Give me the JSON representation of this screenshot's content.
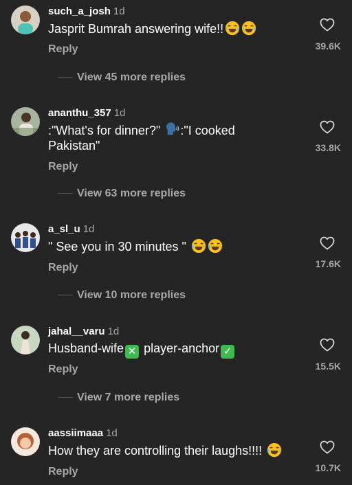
{
  "comments": [
    {
      "username": "such_a_josh",
      "time": "1d",
      "text": "Jasprit Bumrah answering wife!!",
      "reply_label": "Reply",
      "likes": "39.6K",
      "more_replies": "View 45 more replies"
    },
    {
      "username": "ananthu_357",
      "time": "1d",
      "text_a": ":\"What's for dinner?\"",
      "text_b": ":\"I cooked Pakistan\"",
      "reply_label": "Reply",
      "likes": "33.8K",
      "more_replies": "View 63 more replies"
    },
    {
      "username": "a_sl_u",
      "time": "1d",
      "text": "\" See you in 30 minutes \"",
      "reply_label": "Reply",
      "likes": "17.6K",
      "more_replies": "View 10 more replies"
    },
    {
      "username": "jahal__varu",
      "time": "1d",
      "text_a": "Husband-wife",
      "text_b": "player-anchor",
      "reply_label": "Reply",
      "likes": "15.5K",
      "more_replies": "View 7 more replies"
    },
    {
      "username": "aassiimaaa",
      "time": "1d",
      "text": "How they are controlling their laughs!!!!",
      "reply_label": "Reply",
      "likes": "10.7K"
    }
  ],
  "icons": {
    "like": "heart-outline-icon",
    "laugh": "tears-of-joy-emoji",
    "speaking_head": "speaking-head-emoji",
    "cross_mark": "cross-mark-emoji",
    "check_mark": "check-mark-emoji"
  },
  "colors": {
    "background": "#252526",
    "text_primary": "#ffffff",
    "text_secondary": "#a8a8a8",
    "cross_emoji": "#3fb950",
    "check_emoji": "#3fb950"
  }
}
